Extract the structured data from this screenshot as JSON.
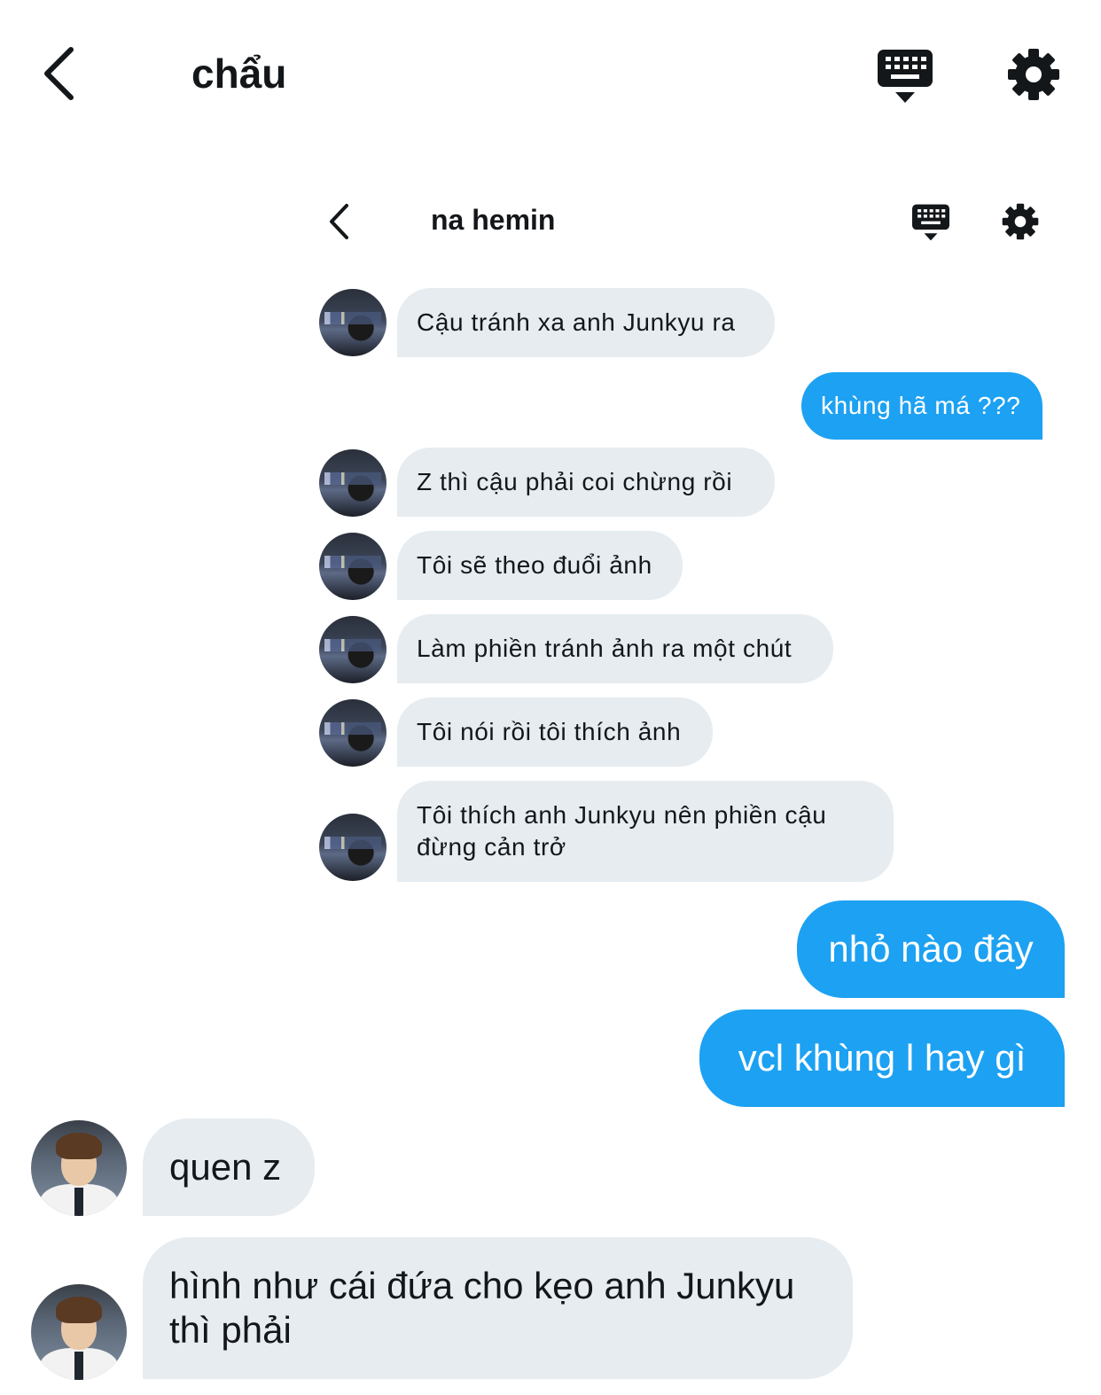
{
  "outer_header": {
    "title": "chẩu"
  },
  "inner_header": {
    "title": "na hemin"
  },
  "inner_messages": [
    {
      "from": "them",
      "text": "Cậu tránh xa anh Junkyu ra"
    },
    {
      "from": "me",
      "text": "khùng hã má ???"
    },
    {
      "from": "them",
      "text": "Z thì cậu phải coi chừng rồi"
    },
    {
      "from": "them",
      "text": "Tôi sẽ theo đuổi ảnh"
    },
    {
      "from": "them",
      "text": "Làm phiền tránh ảnh ra một chút"
    },
    {
      "from": "them",
      "text": "Tôi nói rồi tôi thích ảnh"
    },
    {
      "from": "them",
      "text": "Tôi thích anh Junkyu nên phiền cậu đừng cản trở"
    }
  ],
  "outer_messages": [
    {
      "from": "me",
      "text": "nhỏ nào đây"
    },
    {
      "from": "me",
      "text": "vcl khùng l hay gì"
    },
    {
      "from": "them",
      "text": "quen z"
    },
    {
      "from": "them",
      "text": "hình như cái đứa cho kẹo anh Junkyu thì phải"
    }
  ],
  "colors": {
    "outgoing": "#1da1f2",
    "incoming": "#e6ecf0",
    "text_dark": "#14171a"
  },
  "icons": [
    "back-chevron-icon",
    "keyboard-icon",
    "gear-icon"
  ]
}
